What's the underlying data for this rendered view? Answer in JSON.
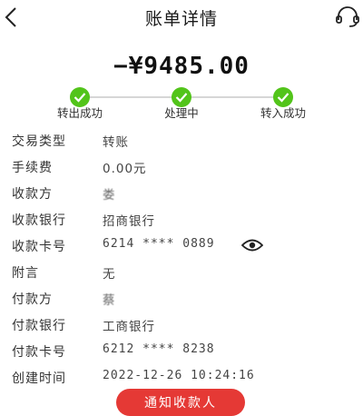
{
  "header": {
    "title": "账单详情"
  },
  "amount": "−¥9485.00",
  "steps": [
    {
      "label": "转出成功"
    },
    {
      "label": "处理中"
    },
    {
      "label": "转入成功"
    }
  ],
  "details": [
    {
      "label": "交易类型",
      "value": "转账"
    },
    {
      "label": "手续费",
      "value": "0.00元"
    },
    {
      "label": "收款方",
      "value": "娄"
    },
    {
      "label": "收款银行",
      "value": "招商银行"
    },
    {
      "label": "收款卡号",
      "value": "6214 **** 0889"
    },
    {
      "label": "附言",
      "value": "无"
    },
    {
      "label": "付款方",
      "value": "蔡"
    },
    {
      "label": "付款银行",
      "value": "工商银行"
    },
    {
      "label": "付款卡号",
      "value": "6212 **** 8238"
    },
    {
      "label": "创建时间",
      "value": "2022-12-26 10:24:16"
    }
  ],
  "notify_button": {
    "label": "通知收款人"
  },
  "colors": {
    "success": "#52c41a",
    "primary": "#e53935"
  },
  "icons": {
    "back": "back-arrow-icon",
    "support": "customer-service-icon",
    "eye": "eye-icon",
    "check": "check-icon"
  }
}
